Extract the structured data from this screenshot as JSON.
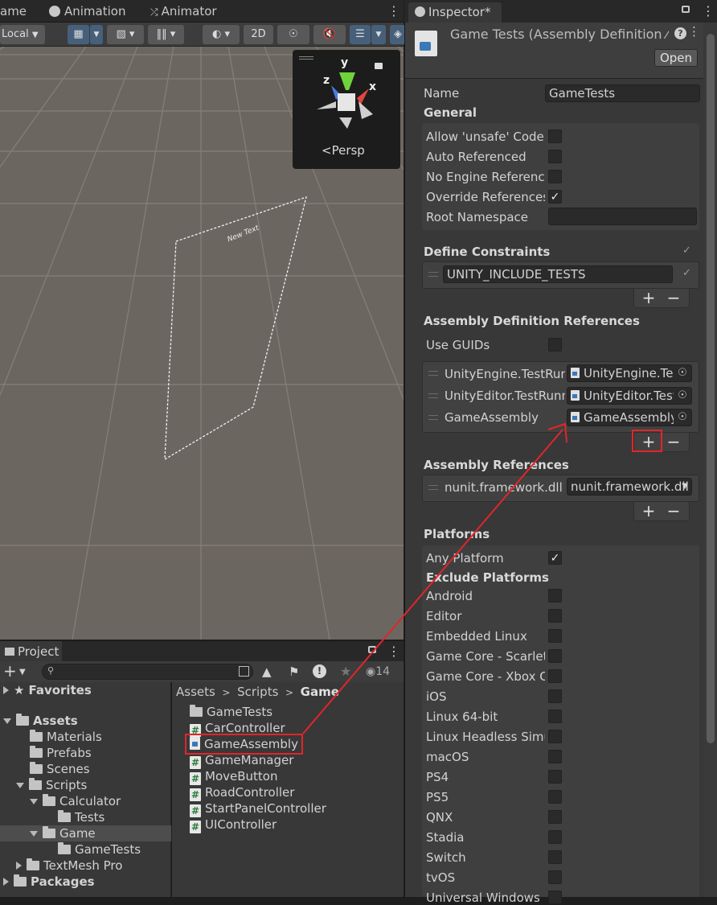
{
  "top_tabs": {
    "game": "ame",
    "animation": "Animation",
    "animator": "Animator"
  },
  "toolbar": {
    "local": "Local",
    "twod": "2D"
  },
  "scene": {
    "persp": "Persp",
    "gizmo_axes": {
      "y": "y",
      "x": "x",
      "z": "z"
    },
    "canvas_text": "New Text"
  },
  "project": {
    "tab": "Project",
    "search_placeholder": "",
    "hidden_count": "14",
    "tree": [
      {
        "label": "Favorites"
      },
      {
        "label": "Assets"
      },
      {
        "label": "Materials"
      },
      {
        "label": "Prefabs"
      },
      {
        "label": "Scenes"
      },
      {
        "label": "Scripts"
      },
      {
        "label": "Calculator"
      },
      {
        "label": "Tests"
      },
      {
        "label": "Game"
      },
      {
        "label": "GameTests"
      },
      {
        "label": "TextMesh Pro"
      },
      {
        "label": "Packages"
      }
    ],
    "breadcrumb": {
      "assets": "Assets",
      "scripts": "Scripts",
      "game": "Game"
    },
    "files": [
      {
        "label": "GameTests"
      },
      {
        "label": "CarController"
      },
      {
        "label": "GameAssembly"
      },
      {
        "label": "GameManager"
      },
      {
        "label": "MoveButton"
      },
      {
        "label": "RoadController"
      },
      {
        "label": "StartPanelController"
      },
      {
        "label": "UIController"
      }
    ]
  },
  "inspector": {
    "tab": "Inspector*",
    "title": "Game Tests (Assembly Definition ⁄",
    "open_label": "Open",
    "name_label": "Name",
    "name_value": "GameTests",
    "general": {
      "header": "General",
      "allow_unsafe": "Allow 'unsafe' Code",
      "auto_referenced": "Auto Referenced",
      "no_engine_references": "No Engine References",
      "override_references": "Override References",
      "root_namespace": "Root Namespace"
    },
    "define_constraints": {
      "header": "Define Constraints",
      "value": "UNITY_INCLUDE_TESTS"
    },
    "asmdef_refs": {
      "header": "Assembly Definition References",
      "use_guids": "Use GUIDs",
      "items": [
        {
          "label": "UnityEngine.TestRunner",
          "value": "UnityEngine.TestRunner"
        },
        {
          "label": "UnityEditor.TestRunner",
          "value": "UnityEditor.TestRunner"
        },
        {
          "label": "GameAssembly",
          "value": "GameAssembly"
        }
      ]
    },
    "assembly_refs": {
      "header": "Assembly References",
      "items": [
        {
          "label": "nunit.framework.dll",
          "value": "nunit.framework.dll"
        }
      ]
    },
    "platforms": {
      "header": "Platforms",
      "any_platform": "Any Platform",
      "exclude_header": "Exclude Platforms",
      "items": [
        "Android",
        "Editor",
        "Embedded Linux",
        "Game Core - Scarlett",
        "Game Core - Xbox One",
        "iOS",
        "Linux 64-bit",
        "Linux Headless Simulation",
        "macOS",
        "PS4",
        "PS5",
        "QNX",
        "Stadia",
        "Switch",
        "tvOS",
        "Universal Windows Platform"
      ]
    },
    "plus": "+",
    "minus": "−"
  },
  "colors": {
    "highlight": "#e0262b",
    "accent_blue": "#46607c"
  }
}
